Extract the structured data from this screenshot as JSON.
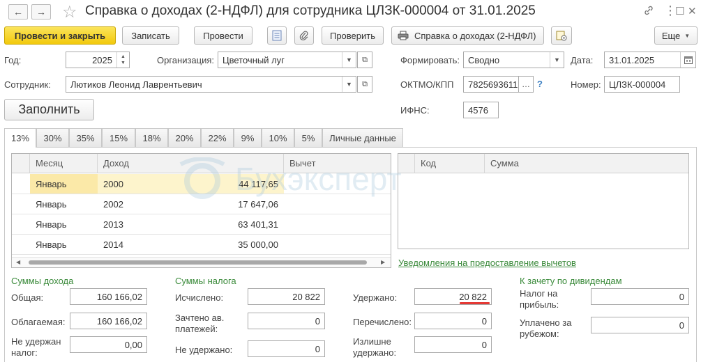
{
  "window": {
    "title": "Справка о доходах (2-НДФЛ) для сотрудника ЦЛЗК-000004 от 31.01.2025"
  },
  "icons": {
    "back": "←",
    "forward": "→",
    "star": "☆",
    "link": "🔗",
    "more": "⋮",
    "maximize": "☐",
    "close": "✕"
  },
  "toolbar": {
    "post_close": "Провести и закрыть",
    "save": "Записать",
    "post": "Провести",
    "check": "Проверить",
    "print": "Справка о доходах (2-НДФЛ)",
    "more": "Еще"
  },
  "form": {
    "year_label": "Год:",
    "year_value": "2025",
    "org_label": "Организация:",
    "org_value": "Цветочный луг",
    "form_label": "Формировать:",
    "form_value": "Сводно",
    "date_label": "Дата:",
    "date_value": "31.01.2025",
    "employee_label": "Сотрудник:",
    "employee_value": "Лютиков Леонид Лаврентьевич",
    "oktmo_label": "ОКТМО/КПП",
    "oktmo_value": "7825693611",
    "number_label": "Номер:",
    "number_value": "ЦЛЗК-000004",
    "ifns_label": "ИФНС:",
    "ifns_value": "4576",
    "fill_button": "Заполнить",
    "help": "?"
  },
  "tabs": [
    "13%",
    "30%",
    "35%",
    "15%",
    "18%",
    "20%",
    "22%",
    "9%",
    "10%",
    "5%",
    "Личные данные"
  ],
  "income_table": {
    "columns": [
      "Месяц",
      "Доход",
      "Вычет"
    ],
    "rows": [
      {
        "month": "Январь",
        "code": "2000",
        "amount": "44 117,65"
      },
      {
        "month": "Январь",
        "code": "2002",
        "amount": "17 647,06"
      },
      {
        "month": "Январь",
        "code": "2013",
        "amount": "63 401,31"
      },
      {
        "month": "Январь",
        "code": "2014",
        "amount": "35 000,00"
      }
    ]
  },
  "deduction_table": {
    "columns": [
      "Код",
      "Сумма"
    ]
  },
  "deduction_link": "Уведомления на предоставление вычетов",
  "watermark": "Бухэксперт",
  "income_sums": {
    "heading": "Суммы дохода",
    "total_label": "Общая:",
    "total_value": "160 166,02",
    "taxable_label": "Облагаемая:",
    "taxable_value": "160 166,02",
    "not_withheld_label": "Не удержан налог:",
    "not_withheld_value": "0,00"
  },
  "tax_sums": {
    "heading": "Суммы налога",
    "calculated_label": "Исчислено:",
    "calculated_value": "20 822",
    "advance_label": "Зачтено ав. платежей:",
    "advance_value": "0",
    "not_withheld_label": "Не удержано:",
    "not_withheld_value": "0",
    "withheld_label": "Удержано:",
    "withheld_value": "20 822",
    "transferred_label": "Перечислено:",
    "transferred_value": "0",
    "excess_label": "Излишне удержано:",
    "excess_value": "0"
  },
  "dividends": {
    "heading": "К зачету по дивидендам",
    "profit_tax_label": "Налог на прибыль:",
    "profit_tax_value": "0",
    "abroad_label": "Уплачено за рубежом:",
    "abroad_value": "0"
  },
  "colors": {
    "primary_button": "#f2c90d",
    "green_heading": "#3a8a3a",
    "selected_row": "#fbe9a8",
    "underline_mark": "#e53935"
  }
}
